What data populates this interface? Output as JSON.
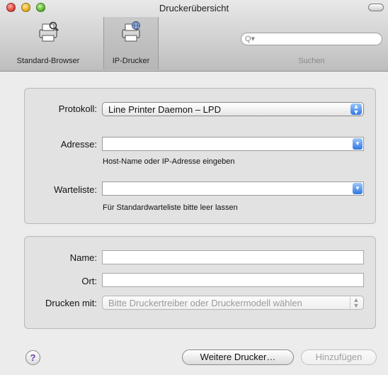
{
  "window": {
    "title": "Druckerübersicht"
  },
  "toolbar": {
    "items": [
      {
        "label": "Standard-Browser",
        "icon": "printer-search-icon",
        "selected": false
      },
      {
        "label": "IP-Drucker",
        "icon": "printer-network-icon",
        "selected": true
      }
    ],
    "search": {
      "placeholder": "",
      "label": "Suchen"
    }
  },
  "form": {
    "protocol": {
      "label": "Protokoll:",
      "value": "Line Printer Daemon – LPD"
    },
    "address": {
      "label": "Adresse:",
      "value": "",
      "hint": "Host-Name oder IP-Adresse eingeben"
    },
    "queue": {
      "label": "Warteliste:",
      "value": "",
      "hint": "Für Standardwarteliste bitte leer lassen"
    },
    "name": {
      "label": "Name:",
      "value": ""
    },
    "location": {
      "label": "Ort:",
      "value": ""
    },
    "print_with": {
      "label": "Drucken mit:",
      "value": "Bitte Druckertreiber oder Druckermodell wählen"
    }
  },
  "buttons": {
    "help": "?",
    "more_printers": "Weitere Drucker…",
    "add": "Hinzufügen"
  },
  "colors": {
    "accent": "#2f78e0",
    "help": "#6b3fa8"
  }
}
